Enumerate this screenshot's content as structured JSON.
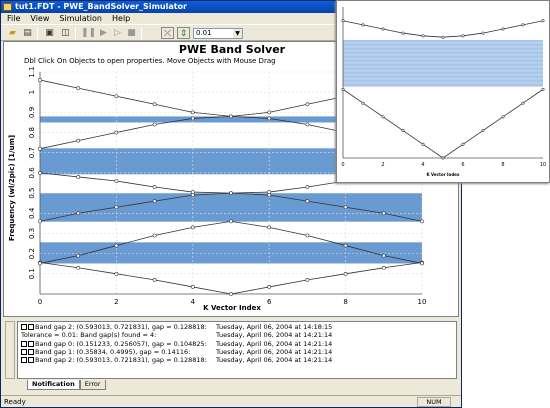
{
  "window": {
    "title": "tut1.FDT - PWE_BandSolver_Simulator",
    "buttons": {
      "minimize": "_",
      "maximize": "□",
      "close": "×"
    }
  },
  "menu": [
    "File",
    "View",
    "Simulation",
    "Help"
  ],
  "toolbar": {
    "step_value": "0.01",
    "icons": [
      "folder-open-icon",
      "print-icon",
      "properties-icon",
      "layout-icon",
      "pause-icon",
      "play-icon",
      "step-icon",
      "stop-icon",
      "curve-icon",
      "up-down-icon"
    ]
  },
  "plot": {
    "title": "PWE Band Solver",
    "subtitle": "Dbl Click On Objects to open properties.  Move Objects with Mouse Drag",
    "xlabel": "K Vector Index",
    "ylabel": "Frequency (wl/2pic) [1/um]"
  },
  "chart_data": [
    {
      "type": "line",
      "title": "PWE Band Solver",
      "xlabel": "K Vector Index",
      "ylabel": "Frequency (wl/2pic) [1/um]",
      "xlim": [
        0,
        10
      ],
      "ylim": [
        0,
        1.1
      ],
      "xticks": [
        0,
        2,
        4,
        6,
        8,
        10
      ],
      "yticks": [
        0.1,
        0.2,
        0.3,
        0.4,
        0.5,
        0.6,
        0.7,
        0.8,
        0.9,
        1.0,
        1.1
      ],
      "grid": true,
      "x": [
        0,
        1,
        2,
        3,
        4,
        5,
        6,
        7,
        8,
        9,
        10
      ],
      "series": [
        {
          "values": [
            0.156,
            0.13,
            0.1,
            0.07,
            0.035,
            0.0,
            0.035,
            0.07,
            0.1,
            0.13,
            0.156
          ]
        },
        {
          "values": [
            0.152,
            0.19,
            0.24,
            0.29,
            0.33,
            0.36,
            0.33,
            0.29,
            0.24,
            0.19,
            0.152
          ]
        },
        {
          "values": [
            0.36,
            0.4,
            0.43,
            0.46,
            0.49,
            0.5,
            0.49,
            0.46,
            0.43,
            0.4,
            0.36
          ]
        },
        {
          "values": [
            0.6,
            0.58,
            0.56,
            0.53,
            0.505,
            0.5,
            0.505,
            0.53,
            0.56,
            0.58,
            0.6
          ]
        },
        {
          "values": [
            0.72,
            0.76,
            0.8,
            0.84,
            0.87,
            0.88,
            0.87,
            0.84,
            0.8,
            0.76,
            0.72
          ]
        },
        {
          "values": [
            1.06,
            1.02,
            0.98,
            0.94,
            0.9,
            0.88,
            0.9,
            0.94,
            0.98,
            1.02,
            1.06
          ]
        }
      ],
      "band_gaps": [
        [
          0.151233,
          0.256057
        ],
        [
          0.35834,
          0.4995
        ],
        [
          0.593013,
          0.721831
        ],
        [
          0.85,
          0.88
        ]
      ],
      "band_color": "#6a9ad2"
    },
    {
      "type": "line",
      "xlabel": "K Vector Index",
      "xlim": [
        0,
        10
      ],
      "xticks": [
        0,
        2,
        4,
        6,
        8,
        10
      ],
      "grid": false,
      "x": [
        0,
        1,
        2,
        3,
        4,
        5,
        6,
        7,
        8,
        9,
        10
      ],
      "series": [
        {
          "values": [
            0.5,
            0.4,
            0.3,
            0.2,
            0.1,
            0.0,
            0.1,
            0.2,
            0.3,
            0.4,
            0.5
          ]
        },
        {
          "values": [
            1.0,
            0.97,
            0.94,
            0.91,
            0.89,
            0.88,
            0.89,
            0.91,
            0.94,
            0.97,
            1.0
          ]
        }
      ],
      "band_gaps": [
        [
          0.52,
          0.86
        ]
      ],
      "band_color": "#a8c6ea"
    }
  ],
  "notifications": [
    {
      "msg": "Band gap 2: (0.593013, 0.721831), gap = 0.128818:",
      "time": "Tuesday, April 06, 2004 at 14:18:15",
      "checkbox": true
    },
    {
      "msg": "Tolerance = 0.01: Band gap(s) found = 4:",
      "time": "Tuesday, April 06, 2004 at 14:21:14",
      "checkbox": false
    },
    {
      "msg": "Band gap 0: (0.151233, 0.256057), gap = 0.104825:",
      "time": "Tuesday, April 06, 2004 at 14:21:14",
      "checkbox": true
    },
    {
      "msg": "Band gap 1: (0.35834, 0.4995), gap = 0.14116:",
      "time": "Tuesday, April 06, 2004 at 14:21:14",
      "checkbox": true
    },
    {
      "msg": "Band gap 2: (0.593013, 0.721831), gap = 0.128818:",
      "time": "Tuesday, April 06, 2004 at 14:21:14",
      "checkbox": true
    }
  ],
  "tabs": [
    "Notification",
    "Error"
  ],
  "status": {
    "left": "Ready",
    "num": "NUM"
  }
}
